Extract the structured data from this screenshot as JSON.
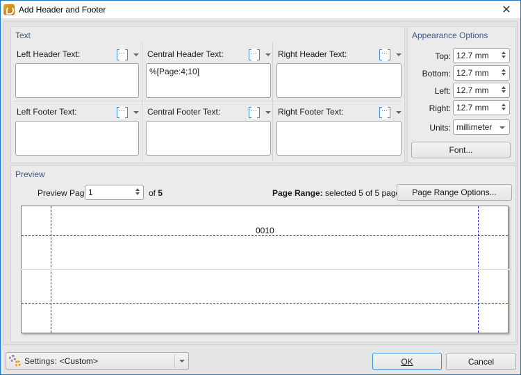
{
  "window": {
    "title": "Add Header and Footer",
    "close_glyph": "✕"
  },
  "text_group": {
    "title": "Text",
    "cells": {
      "left_header": {
        "label": "Left Header Text:",
        "value": ""
      },
      "central_header": {
        "label": "Central Header Text:",
        "value": "%[Page:4;10]"
      },
      "right_header": {
        "label": "Right Header Text:",
        "value": ""
      },
      "left_footer": {
        "label": "Left Footer Text:",
        "value": ""
      },
      "central_footer": {
        "label": "Central Footer Text:",
        "value": ""
      },
      "right_footer": {
        "label": "Right Footer Text:",
        "value": ""
      }
    }
  },
  "appearance": {
    "title": "Appearance Options",
    "top": {
      "label": "Top:",
      "value": "12.7 mm"
    },
    "bottom": {
      "label": "Bottom:",
      "value": "12.7 mm"
    },
    "left": {
      "label": "Left:",
      "value": "12.7 mm"
    },
    "right": {
      "label": "Right:",
      "value": "12.7 mm"
    },
    "units": {
      "label": "Units:",
      "value": "millimeter"
    },
    "font_button": "Font..."
  },
  "preview": {
    "title": "Preview",
    "page_label": "Preview Page",
    "page_value": "1",
    "of_label": "of",
    "total_pages": "5",
    "range_label": "Page Range:",
    "range_text_prefix": "selected",
    "range_selected": "5",
    "range_of": "of",
    "range_total": "5",
    "range_suffix": "pages",
    "range_button": "Page Range Options...",
    "header_sample": "0010"
  },
  "footer": {
    "settings_label": "Settings:",
    "settings_value": "<Custom>",
    "ok_button": "OK",
    "cancel_button": "Cancel"
  }
}
